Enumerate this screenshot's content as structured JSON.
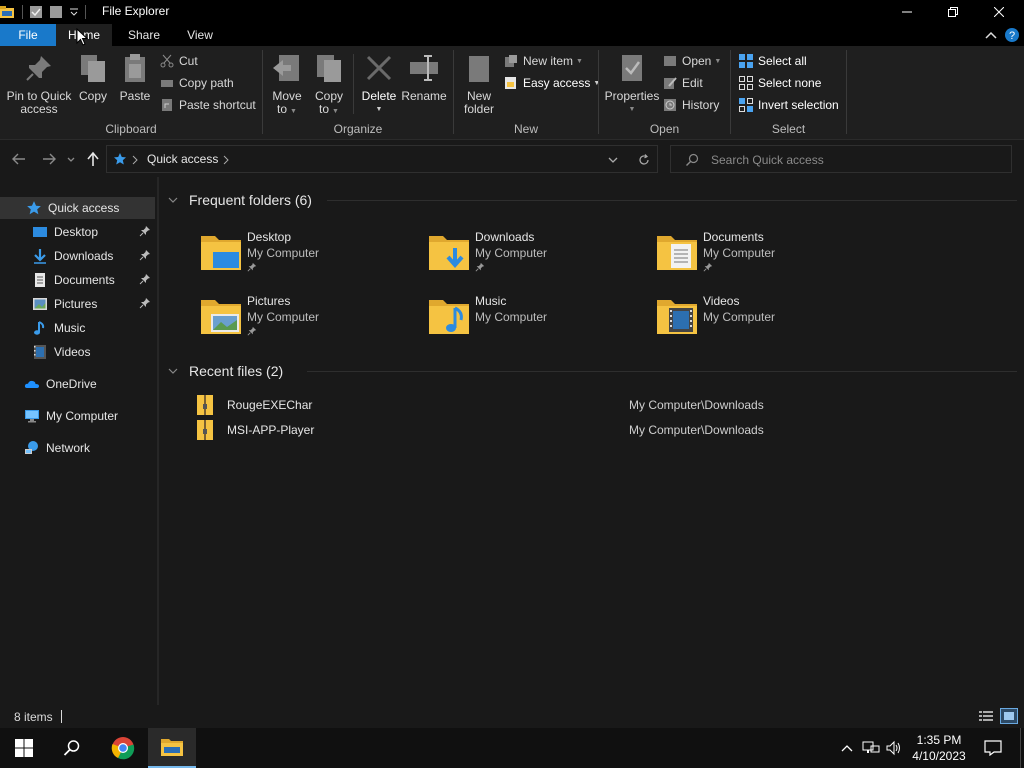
{
  "window": {
    "title": "File Explorer",
    "controls": [
      "minimize",
      "maximize",
      "close"
    ]
  },
  "ribbon_tabs": {
    "file": "File",
    "home": "Home",
    "share": "Share",
    "view": "View"
  },
  "ribbon": {
    "clipboard": {
      "label": "Clipboard",
      "pin_line1": "Pin to Quick",
      "pin_line2": "access",
      "copy": "Copy",
      "paste": "Paste",
      "cut": "Cut",
      "copy_path": "Copy path",
      "paste_shortcut": "Paste shortcut"
    },
    "organize": {
      "label": "Organize",
      "move_line1": "Move",
      "move_line2": "to",
      "copy_line1": "Copy",
      "copy_line2": "to",
      "delete": "Delete",
      "rename": "Rename"
    },
    "new": {
      "label": "New",
      "new_folder_line1": "New",
      "new_folder_line2": "folder",
      "new_item": "New item",
      "easy_access": "Easy access"
    },
    "open": {
      "label": "Open",
      "properties": "Properties",
      "open": "Open",
      "edit": "Edit",
      "history": "History"
    },
    "select": {
      "label": "Select",
      "select_all": "Select all",
      "select_none": "Select none",
      "invert": "Invert selection"
    }
  },
  "nav": {
    "breadcrumb": "Quick access",
    "search_placeholder": "Search Quick access"
  },
  "sidebar": {
    "items": [
      {
        "label": "Quick access",
        "icon": "star-icon",
        "selected": true
      },
      {
        "label": "Desktop",
        "icon": "desktop-icon",
        "pinned": true
      },
      {
        "label": "Downloads",
        "icon": "download-icon",
        "pinned": true
      },
      {
        "label": "Documents",
        "icon": "document-icon",
        "pinned": true
      },
      {
        "label": "Pictures",
        "icon": "picture-icon",
        "pinned": true
      },
      {
        "label": "Music",
        "icon": "music-icon"
      },
      {
        "label": "Videos",
        "icon": "video-icon"
      },
      {
        "label": "OneDrive",
        "icon": "cloud-icon"
      },
      {
        "label": "My Computer",
        "icon": "computer-icon"
      },
      {
        "label": "Network",
        "icon": "network-icon"
      }
    ]
  },
  "content": {
    "frequent_header": "Frequent folders (6)",
    "recent_header": "Recent files (2)",
    "folders": [
      {
        "name": "Desktop",
        "location": "My Computer",
        "pinned": true
      },
      {
        "name": "Downloads",
        "location": "My Computer",
        "pinned": true
      },
      {
        "name": "Documents",
        "location": "My Computer",
        "pinned": true
      },
      {
        "name": "Pictures",
        "location": "My Computer",
        "pinned": true
      },
      {
        "name": "Music",
        "location": "My Computer",
        "pinned": false
      },
      {
        "name": "Videos",
        "location": "My Computer",
        "pinned": false
      }
    ],
    "recent_files": [
      {
        "name": "RougeEXEChar",
        "path": "My Computer\\Downloads"
      },
      {
        "name": "MSI-APP-Player",
        "path": "My Computer\\Downloads"
      }
    ]
  },
  "status": {
    "item_count": "8 items"
  },
  "taskbar": {
    "clock_time": "1:35 PM",
    "clock_date": "4/10/2023"
  },
  "colors": {
    "accent": "#1979ca",
    "folder": "#f5c342",
    "background": "#191919"
  }
}
